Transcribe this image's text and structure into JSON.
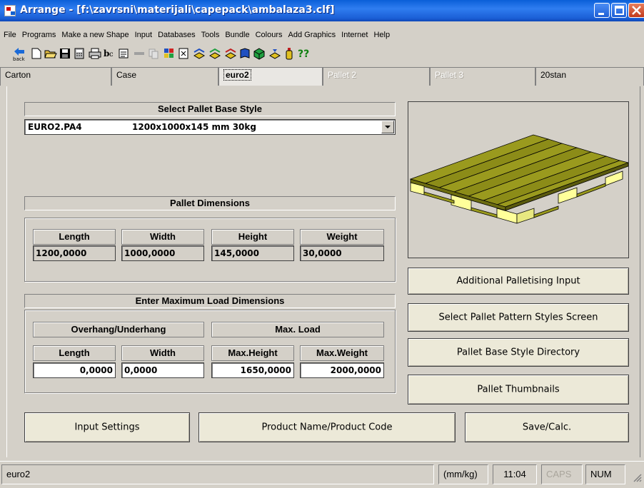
{
  "window": {
    "title": "Arrange - [f:\\zavrsni\\materijali\\capepack\\ambalaza3.clf]"
  },
  "menu": [
    "File",
    "Programs",
    "Make a new Shape",
    "Input",
    "Databases",
    "Tools",
    "Bundle",
    "Colours",
    "Add Graphics",
    "Internet",
    "Help"
  ],
  "toolbar": {
    "back_label": "back",
    "icons": [
      "back-icon",
      "new-icon",
      "open-icon",
      "save-icon",
      "calculator-icon",
      "print-icon",
      "spell-icon",
      "report-icon",
      "blank-icon",
      "copy-icon",
      "pallet-pattern-icon",
      "document-icon",
      "stack-icon",
      "stack2-icon",
      "stack3-icon",
      "book-icon",
      "cube-icon",
      "arrange-icon",
      "bottle-icon",
      "help-icon"
    ],
    "help_text": "??"
  },
  "tabs": [
    {
      "label": "Carton",
      "state": "normal"
    },
    {
      "label": "Case",
      "state": "normal"
    },
    {
      "label": "euro2",
      "state": "active"
    },
    {
      "label": "Pallet 2",
      "state": "disabled"
    },
    {
      "label": "Pallet 3",
      "state": "disabled"
    },
    {
      "label": "20stan",
      "state": "normal"
    }
  ],
  "pallet_base": {
    "header": "Select Pallet Base Style",
    "selected_code": "EURO2.PA4",
    "selected_desc": "1200x1000x145 mm 30kg"
  },
  "pallet_dimensions": {
    "header": "Pallet Dimensions",
    "labels": {
      "length": "Length",
      "width": "Width",
      "height": "Height",
      "weight": "Weight"
    },
    "values": {
      "length": "1200,0000",
      "width": "1000,0000",
      "height": "145,0000",
      "weight": "30,0000"
    }
  },
  "max_load": {
    "header": "Enter Maximum Load Dimensions",
    "overhang_header": "Overhang/Underhang",
    "maxload_header": "Max. Load",
    "labels": {
      "length": "Length",
      "width": "Width",
      "max_height": "Max.Height",
      "max_weight": "Max.Weight"
    },
    "values": {
      "length": "0,0000",
      "width": "0,0000",
      "max_height": "1650,0000",
      "max_weight": "2000,0000"
    }
  },
  "side_buttons": {
    "additional": "Additional Palletising Input",
    "pattern_styles": "Select Pallet Pattern Styles Screen",
    "base_directory": "Pallet Base Style Directory",
    "thumbnails": "Pallet Thumbnails"
  },
  "bottom_buttons": {
    "input_settings": "Input Settings",
    "product_name": "Product Name/Product Code",
    "save_calc": "Save/Calc."
  },
  "status": {
    "name": "euro2",
    "units": "(mm/kg)",
    "time": "11:04",
    "caps": "CAPS",
    "num": "NUM"
  },
  "colors": {
    "pallet_deck": "#9a9a1e",
    "pallet_block": "#ffff9a",
    "titlebar": "#2f7df0"
  }
}
